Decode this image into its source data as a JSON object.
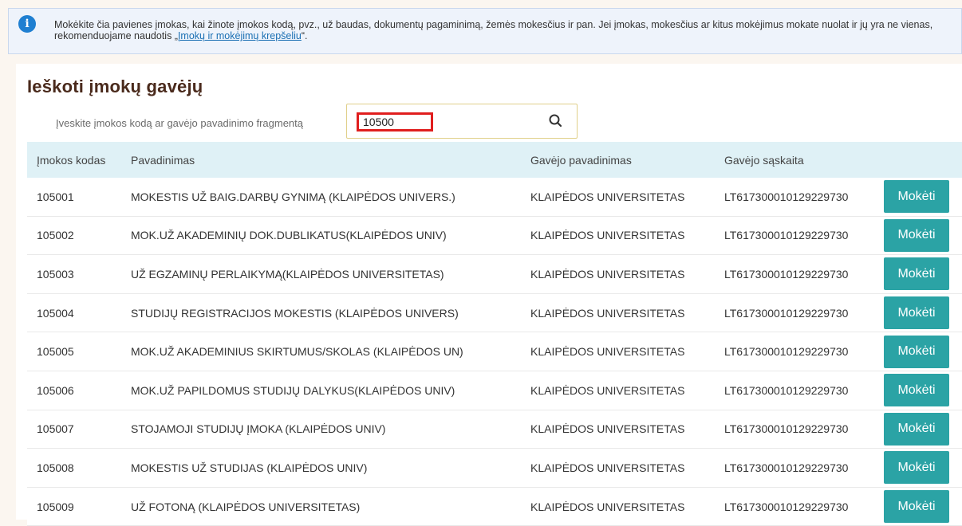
{
  "info": {
    "text_before_link": "Mokėkite čia pavienes įmokas, kai žinote įmokos kodą, pvz., už baudas, dokumentų pagaminimą, žemės mokesčius ir pan. Jei įmokas, mokesčius ar kitus mokėjimus mokate nuolat ir jų yra ne vienas, rekomenduojame naudotis „",
    "link_text": "Įmokų ir mokėjimų krepšeliu",
    "text_after_link": "“."
  },
  "page_title": "Ieškoti įmokų gavėjų",
  "search": {
    "label": "Įveskite įmokos kodą ar gavėjo pavadinimo fragmentą",
    "value": "10500"
  },
  "table": {
    "headers": [
      "Įmokos kodas",
      "Pavadinimas",
      "Gavėjo pavadinimas",
      "Gavėjo sąskaita"
    ],
    "pay_label": "Mokėti",
    "rows": [
      {
        "code": "105001",
        "name": "MOKESTIS UŽ BAIG.DARBŲ GYNIMĄ (KLAIPĖDOS UNIVERS.)",
        "recipient": "KLAIPĖDOS UNIVERSITETAS",
        "account": "LT617300010129229730"
      },
      {
        "code": "105002",
        "name": "MOK.UŽ AKADEMINIŲ DOK.DUBLIKATUS(KLAIPĖDOS UNIV)",
        "recipient": "KLAIPĖDOS UNIVERSITETAS",
        "account": "LT617300010129229730"
      },
      {
        "code": "105003",
        "name": "UŽ EGZAMINŲ PERLAIKYMĄ(KLAIPĖDOS UNIVERSITETAS)",
        "recipient": "KLAIPĖDOS UNIVERSITETAS",
        "account": "LT617300010129229730"
      },
      {
        "code": "105004",
        "name": "STUDIJŲ REGISTRACIJOS MOKESTIS (KLAIPĖDOS UNIVERS)",
        "recipient": "KLAIPĖDOS UNIVERSITETAS",
        "account": "LT617300010129229730"
      },
      {
        "code": "105005",
        "name": "MOK.UŽ AKADEMINIUS SKIRTUMUS/SKOLAS (KLAIPĖDOS UN)",
        "recipient": "KLAIPĖDOS UNIVERSITETAS",
        "account": "LT617300010129229730"
      },
      {
        "code": "105006",
        "name": "MOK.UŽ PAPILDOMUS STUDIJŲ DALYKUS(KLAIPĖDOS UNIV)",
        "recipient": "KLAIPĖDOS UNIVERSITETAS",
        "account": "LT617300010129229730"
      },
      {
        "code": "105007",
        "name": "STOJAMOJI STUDIJŲ ĮMOKA (KLAIPĖDOS UNIV)",
        "recipient": "KLAIPĖDOS UNIVERSITETAS",
        "account": "LT617300010129229730"
      },
      {
        "code": "105008",
        "name": "MOKESTIS UŽ STUDIJAS (KLAIPĖDOS UNIV)",
        "recipient": "KLAIPĖDOS UNIVERSITETAS",
        "account": "LT617300010129229730"
      },
      {
        "code": "105009",
        "name": "UŽ FOTONĄ (KLAIPĖDOS UNIVERSITETAS)",
        "recipient": "KLAIPĖDOS UNIVERSITETAS",
        "account": "LT617300010129229730"
      }
    ]
  },
  "icons": {
    "info": "info-icon",
    "search": "search-icon"
  },
  "colors": {
    "accent": "#2ba3a5",
    "header_bg": "#dff1f6",
    "title": "#4a2a1c",
    "highlight": "#e01e1e"
  }
}
